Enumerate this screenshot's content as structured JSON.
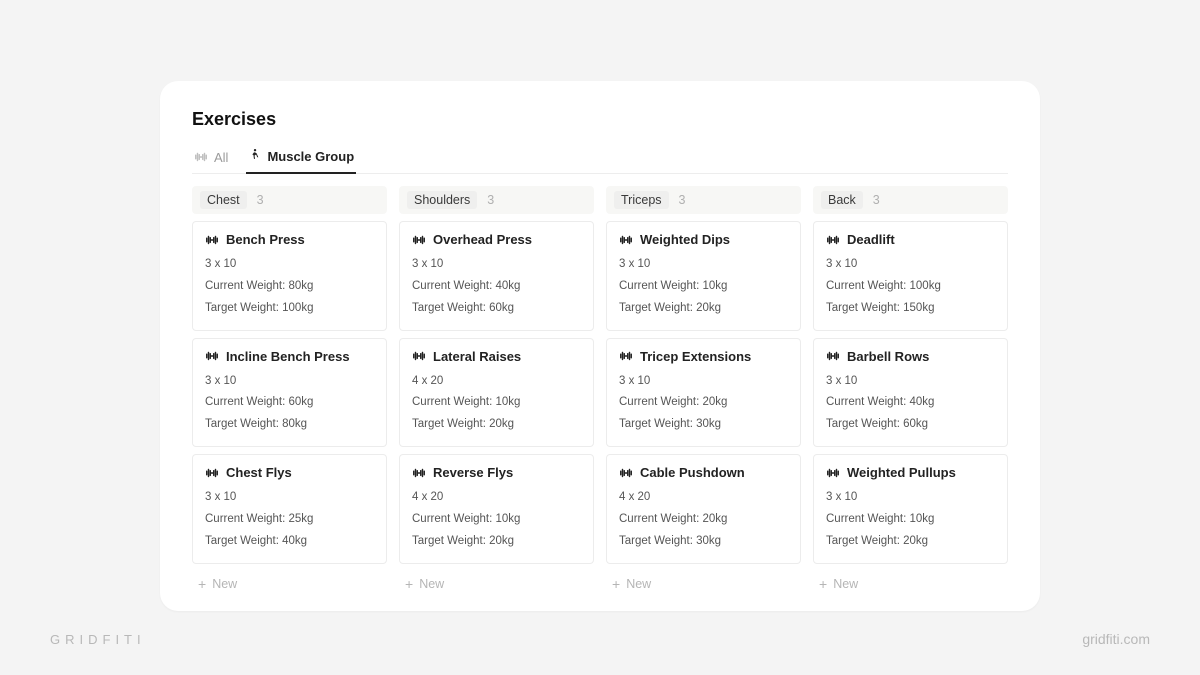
{
  "title": "Exercises",
  "tabs": [
    {
      "label": "All",
      "icon": "dumbbell",
      "active": false
    },
    {
      "label": "Muscle Group",
      "icon": "person",
      "active": true
    }
  ],
  "new_label": "New",
  "columns": [
    {
      "name": "Chest",
      "count": "3",
      "items": [
        {
          "name": "Bench Press",
          "sets": "3 x 10",
          "current": "Current Weight: 80kg",
          "target": "Target Weight: 100kg"
        },
        {
          "name": "Incline Bench Press",
          "sets": "3 x 10",
          "current": "Current Weight: 60kg",
          "target": "Target Weight: 80kg"
        },
        {
          "name": "Chest Flys",
          "sets": "3 x 10",
          "current": "Current Weight: 25kg",
          "target": "Target Weight: 40kg"
        }
      ]
    },
    {
      "name": "Shoulders",
      "count": "3",
      "items": [
        {
          "name": "Overhead Press",
          "sets": "3 x 10",
          "current": "Current Weight: 40kg",
          "target": "Target Weight: 60kg"
        },
        {
          "name": "Lateral Raises",
          "sets": "4 x 20",
          "current": "Current Weight: 10kg",
          "target": "Target Weight: 20kg"
        },
        {
          "name": "Reverse Flys",
          "sets": "4 x 20",
          "current": "Current Weight: 10kg",
          "target": "Target Weight: 20kg"
        }
      ]
    },
    {
      "name": "Triceps",
      "count": "3",
      "items": [
        {
          "name": "Weighted Dips",
          "sets": "3 x 10",
          "current": "Current Weight: 10kg",
          "target": "Target Weight: 20kg"
        },
        {
          "name": "Tricep Extensions",
          "sets": "3 x 10",
          "current": "Current Weight: 20kg",
          "target": "Target Weight: 30kg"
        },
        {
          "name": "Cable Pushdown",
          "sets": "4 x 20",
          "current": "Current Weight: 20kg",
          "target": "Target Weight: 30kg"
        }
      ]
    },
    {
      "name": "Back",
      "count": "3",
      "items": [
        {
          "name": "Deadlift",
          "sets": "3 x 10",
          "current": "Current Weight: 100kg",
          "target": "Target Weight: 150kg"
        },
        {
          "name": "Barbell Rows",
          "sets": "3 x 10",
          "current": "Current Weight: 40kg",
          "target": "Target Weight: 60kg"
        },
        {
          "name": "Weighted Pullups",
          "sets": "3 x 10",
          "current": "Current Weight: 10kg",
          "target": "Target Weight: 20kg"
        }
      ]
    }
  ],
  "watermark_left": "GRIDFITI",
  "watermark_right": "gridfiti.com"
}
